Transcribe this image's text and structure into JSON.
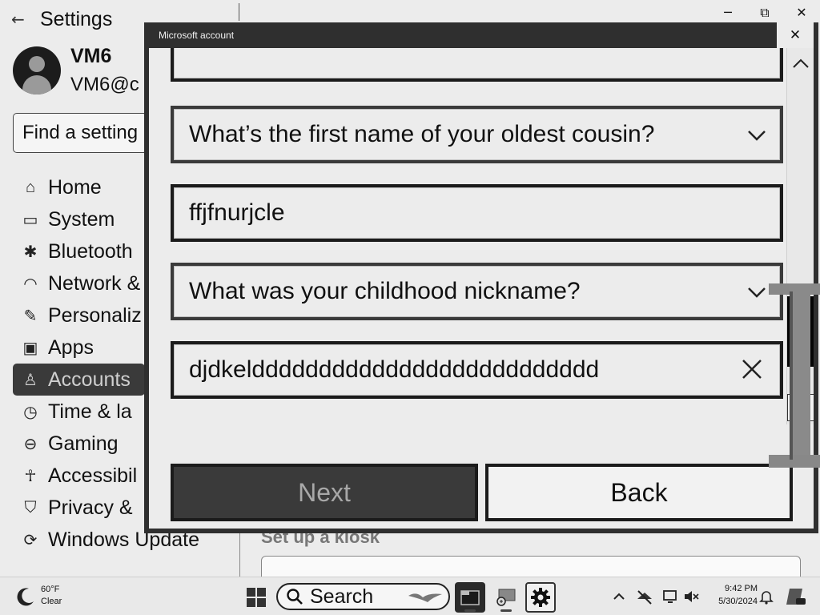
{
  "settings": {
    "title": "Settings",
    "user": {
      "name": "VM6",
      "email": "VM6@c"
    },
    "search_text": "Find a setting",
    "nav": [
      {
        "label": "Home",
        "icon": "home-icon"
      },
      {
        "label": "System",
        "icon": "monitor-icon"
      },
      {
        "label": "Bluetooth",
        "icon": "bluetooth-icon"
      },
      {
        "label": "Network &",
        "icon": "wifi-icon"
      },
      {
        "label": "Personaliz",
        "icon": "brush-icon"
      },
      {
        "label": "Apps",
        "icon": "apps-icon"
      },
      {
        "label": "Accounts",
        "icon": "person-icon",
        "selected": true
      },
      {
        "label": "Time & la",
        "icon": "clock-language-icon"
      },
      {
        "label": "Gaming",
        "icon": "gamepad-icon"
      },
      {
        "label": "Accessibil",
        "icon": "accessibility-icon"
      },
      {
        "label": "Privacy &",
        "icon": "shield-icon"
      },
      {
        "label": "Windows Update",
        "icon": "update-icon"
      }
    ],
    "kiosk_title": "Set up a kiosk",
    "window_controls": {
      "minimize": "─",
      "restore": "⧉",
      "close": "✕"
    }
  },
  "dialog": {
    "title": "Microsoft account",
    "close": "✕",
    "question1": "What’s the first name of your oldest cousin?",
    "answer1": "ffjfnurjcle",
    "question2": "What was your childhood nickname?",
    "answer2": "djdkeldddddddddddddddddddddddddd",
    "next_label": "Next",
    "back_label": "Back"
  },
  "taskbar": {
    "weather": {
      "temp": "60°F",
      "condition": "Clear"
    },
    "search_label": "Search",
    "clock": {
      "time": "9:42 PM",
      "date": "5/30/2024"
    }
  },
  "colors": {
    "dialog_frame": "#2f2f2f",
    "next_button_bg": "#3a3a3a",
    "selected_nav_bg": "#3a3a3a",
    "page_bg": "#ececec"
  }
}
